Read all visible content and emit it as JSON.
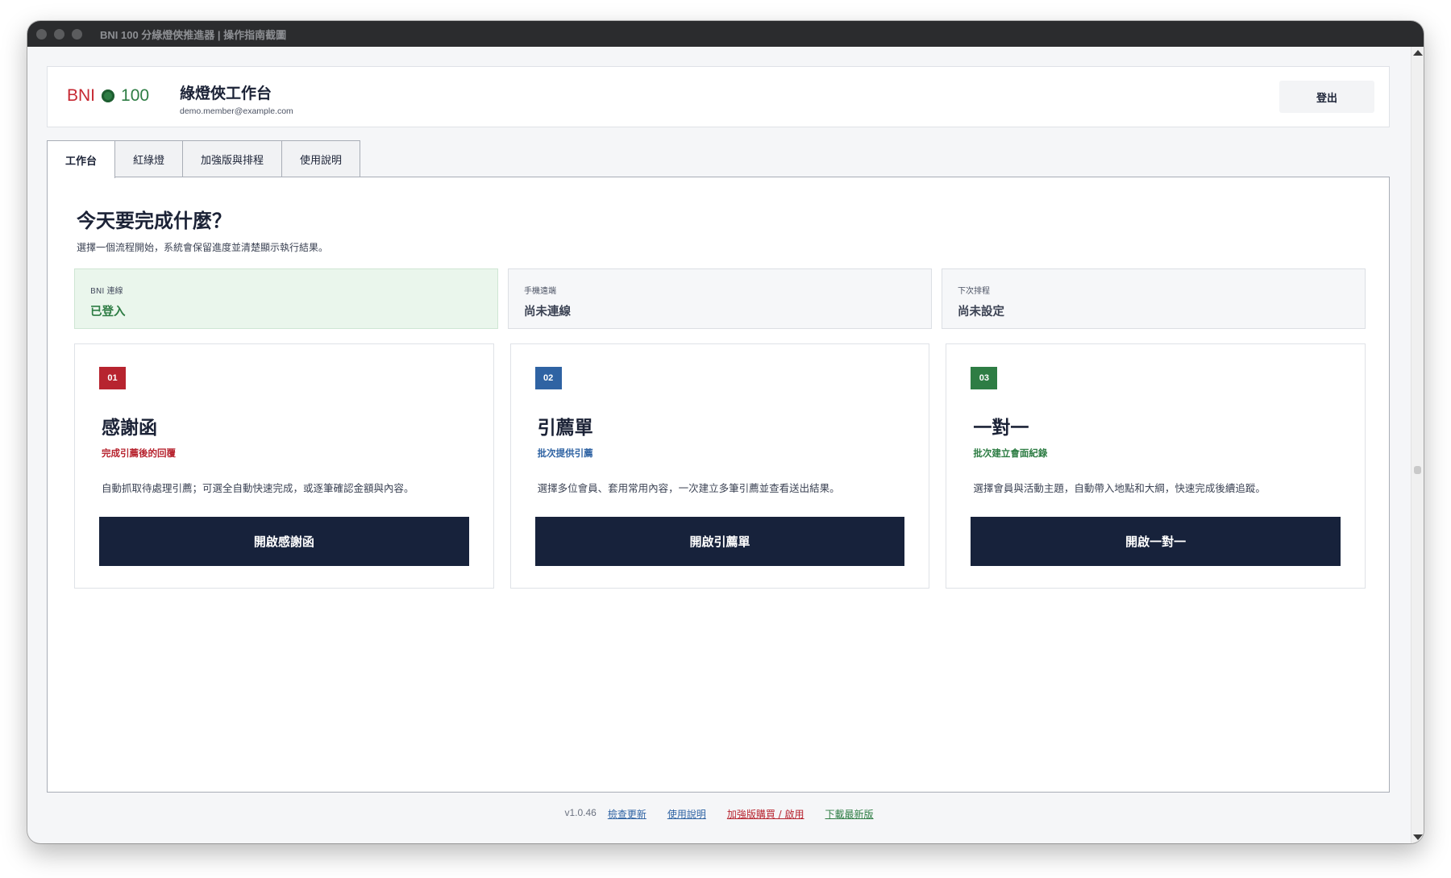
{
  "window": {
    "title": "BNI 100 分綠燈俠推進器 | 操作指南截圖"
  },
  "header": {
    "logo_brand": "BNI",
    "logo_number": "100",
    "title": "綠燈俠工作台",
    "email": "demo.member@example.com",
    "logout_label": "登出"
  },
  "tabs": [
    {
      "label": "工作台",
      "active": true
    },
    {
      "label": "紅綠燈",
      "active": false
    },
    {
      "label": "加強版與排程",
      "active": false
    },
    {
      "label": "使用說明",
      "active": false
    }
  ],
  "main": {
    "heading": "今天要完成什麼？",
    "subheading": "選擇一個流程開始，系統會保留進度並清楚顯示執行結果。"
  },
  "status": [
    {
      "label": "BNI 連線",
      "value": "已登入",
      "state": "ok"
    },
    {
      "label": "手機遠端",
      "value": "尚未連線",
      "state": "idle"
    },
    {
      "label": "下次排程",
      "value": "尚未設定",
      "state": "idle"
    }
  ],
  "cards": [
    {
      "number": "01",
      "title": "感謝函",
      "tag": "完成引薦後的回覆",
      "description": "自動抓取待處理引薦；可選全自動快速完成，或逐筆確認金額與內容。",
      "button_label": "開啟感謝函",
      "color": "#b7242f"
    },
    {
      "number": "02",
      "title": "引薦單",
      "tag": "批次提供引薦",
      "description": "選擇多位會員、套用常用內容，一次建立多筆引薦並查看送出結果。",
      "button_label": "開啟引薦單",
      "color": "#2f63a3"
    },
    {
      "number": "03",
      "title": "一對一",
      "tag": "批次建立會面紀錄",
      "description": "選擇會員與活動主題，自動帶入地點和大綱，快速完成後續追蹤。",
      "button_label": "開啟一對一",
      "color": "#2e7d44"
    }
  ],
  "footer": {
    "version": "v1.0.46",
    "links": [
      {
        "label": "檢查更新",
        "color": "#2f63a3"
      },
      {
        "label": "使用說明",
        "color": "#2f63a3"
      },
      {
        "label": "加強版購買 / 啟用",
        "color": "#b7242f"
      },
      {
        "label": "下載最新版",
        "color": "#2e7d44"
      }
    ]
  },
  "colors": {
    "accent_red": "#c62832",
    "accent_green": "#2e7d44",
    "button_navy": "#17223b",
    "ok_background": "#eaf6ec"
  }
}
